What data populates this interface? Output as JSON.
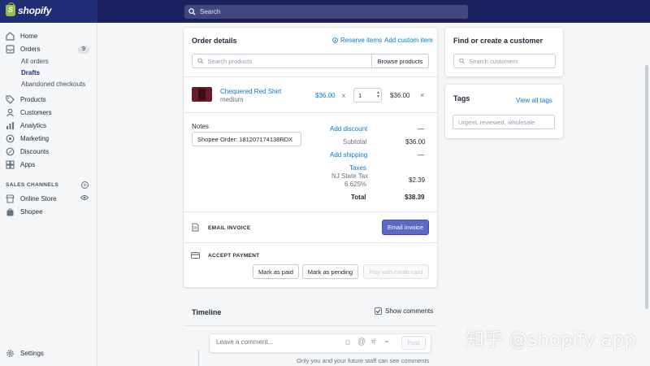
{
  "topbar": {
    "logo_text": "shopify",
    "logo_letter": "S",
    "search_placeholder": "Search"
  },
  "sidebar": {
    "items": [
      {
        "label": "Home",
        "icon": "home-icon"
      },
      {
        "label": "Orders",
        "icon": "orders-icon",
        "badge": "9"
      },
      {
        "label": "Products",
        "icon": "tag-icon"
      },
      {
        "label": "Customers",
        "icon": "person-icon"
      },
      {
        "label": "Analytics",
        "icon": "bar-chart-icon"
      },
      {
        "label": "Marketing",
        "icon": "target-icon"
      },
      {
        "label": "Discounts",
        "icon": "discount-icon"
      },
      {
        "label": "Apps",
        "icon": "apps-icon"
      }
    ],
    "order_subitems": [
      "All orders",
      "Drafts",
      "Abandoned checkouts"
    ],
    "sales_channels_heading": "SALES CHANNELS",
    "channels": [
      {
        "label": "Online Store",
        "icon": "store-icon"
      },
      {
        "label": "Shopee",
        "icon": "shopee-bag-icon"
      }
    ],
    "settings_label": "Settings"
  },
  "order_details": {
    "title": "Order details",
    "reserve_items": "Reserve items",
    "add_custom_item": "Add custom item",
    "search_placeholder": "Search products",
    "browse_button": "Browse products",
    "line_item": {
      "name": "Chequered Red Shirt",
      "variant": "medium",
      "price": "$36.00",
      "times": "x",
      "quantity": "1",
      "total": "$36.00"
    },
    "notes_label": "Notes",
    "notes_value": "Shopee Order: 181207174138RDX",
    "add_discount": "Add discount",
    "discount_value": "—",
    "subtotal_label": "Subtotal",
    "subtotal_value": "$36.00",
    "add_shipping": "Add shipping",
    "shipping_value": "—",
    "taxes_label": "Taxes",
    "tax_name": "NJ State Tax",
    "tax_rate": "6.625%",
    "tax_value": "$2.39",
    "total_label": "Total",
    "total_value": "$38.39",
    "email_invoice_heading": "EMAIL INVOICE",
    "email_invoice_button": "Email invoice",
    "accept_payment_heading": "ACCEPT PAYMENT",
    "mark_paid": "Mark as paid",
    "mark_pending": "Mark as pending",
    "pay_credit_card": "Pay with credit card"
  },
  "customer": {
    "title": "Find or create a customer",
    "search_placeholder": "Search customers"
  },
  "tags": {
    "title": "Tags",
    "view_all": "View all tags",
    "placeholder": "Urgent, reviewed, wholesale"
  },
  "timeline": {
    "title": "Timeline",
    "show_comments": "Show comments",
    "comment_placeholder": "Leave a comment...",
    "post_button": "Post",
    "note": "Only you and your future staff can see comments"
  },
  "watermark": "知乎 @shopify app",
  "colors": {
    "topbar": "#1c2260",
    "primary_button": "#5c6ac4",
    "link": "#007ace",
    "logo_green": "#95bf47"
  }
}
